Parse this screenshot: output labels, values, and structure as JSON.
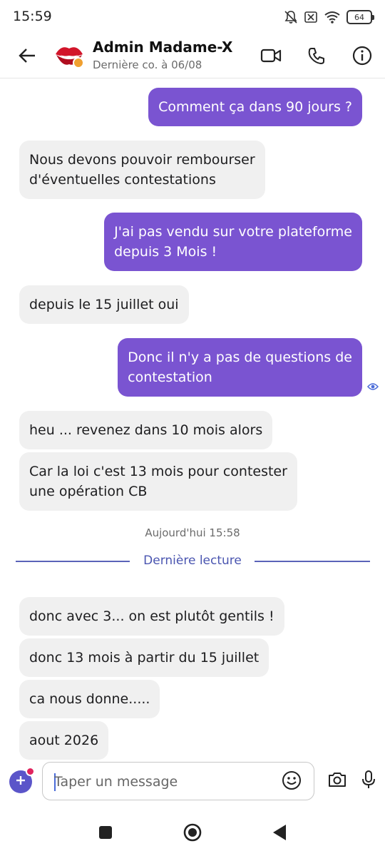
{
  "status_bar": {
    "time": "15:59",
    "battery_level": "64",
    "icons": [
      "bell-off-icon",
      "no-sim-icon",
      "wifi-icon",
      "battery-icon"
    ]
  },
  "header": {
    "contact_name": "Admin Madame-X",
    "contact_status": "Dernière co. à 06/08",
    "icons": [
      "back-arrow-icon",
      "video-call-icon",
      "phone-icon",
      "info-icon"
    ]
  },
  "messages": [
    {
      "dir": "out",
      "text": "Comment ça dans 90 jours ?"
    },
    {
      "dir": "in",
      "text": "Nous devons pouvoir rembourser\nd'éventuelles contestations"
    },
    {
      "dir": "out",
      "text": "J'ai pas vendu sur votre plateforme\ndepuis 3 Mois !"
    },
    {
      "dir": "in",
      "text": "depuis le 15 juillet oui"
    },
    {
      "dir": "out",
      "text": "Donc il n'y a pas de questions de\ncontestation"
    },
    {
      "dir": "in",
      "text": "heu ... revenez dans 10 mois alors"
    },
    {
      "dir": "in",
      "text": "Car la loi c'est 13 mois pour contester\nune opération CB"
    },
    {
      "dir": "in",
      "text": "donc avec 3... on est plutôt gentils !"
    },
    {
      "dir": "in",
      "text": "donc 13 mois à partir du 15 juillet"
    },
    {
      "dir": "in",
      "text": "ca nous donne....."
    },
    {
      "dir": "in",
      "text": "aout 2026"
    }
  ],
  "date_separator": "Aujourd'hui 15:58",
  "read_divider": "Dernière lecture",
  "composer": {
    "placeholder": "Taper un message",
    "value": ""
  },
  "colors": {
    "accent": "#7a54d1",
    "incoming_bubble": "#f0f0f0",
    "divider": "#5a63b8",
    "add_button": "#5b55c9",
    "notification_badge": "#e0245e"
  }
}
